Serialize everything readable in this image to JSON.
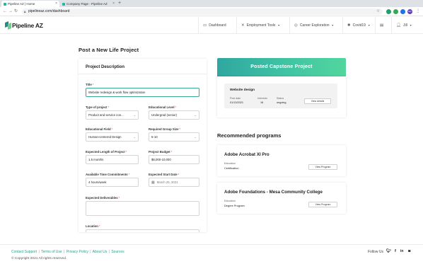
{
  "browser": {
    "tabs": [
      {
        "title": "Pipeline AZ | Home",
        "active": true
      },
      {
        "title": "Company Page - Pipeline AZ",
        "active": false
      }
    ],
    "new_tab": "+",
    "url": "pipelineaz.com/dashboard",
    "avatar": "ED"
  },
  "header": {
    "logo_text": "Pipeline AZ",
    "nav": [
      {
        "label": "Dashboard",
        "icon": "dashboard-icon"
      },
      {
        "label": "Employment Tools",
        "icon": "tools-icon"
      },
      {
        "label": "Career Exploration",
        "icon": "compass-icon"
      },
      {
        "label": "Covid19",
        "icon": "virus-icon"
      }
    ],
    "inbox_icon": "inbox-icon",
    "user": "Jill"
  },
  "page": {
    "title": "Post a New Life Project"
  },
  "form": {
    "section_title": "Project Description",
    "fields": {
      "title": {
        "label": "Title",
        "value": "Website redesign & work flow optimization"
      },
      "type_of_project": {
        "label": "Type of project",
        "value": "Product and service con..."
      },
      "educational_level": {
        "label": "Educational Level",
        "value": "Undergrad (senior)"
      },
      "educational_field": {
        "label": "Educational Field",
        "value": "Human-centered Design"
      },
      "group_size": {
        "label": "Required Group Size",
        "value": "5-10"
      },
      "length": {
        "label": "Expected Length of Project",
        "value": "1.5 months"
      },
      "budget": {
        "label": "Project Budget",
        "value": "$8,000-10,000"
      },
      "time_commitments": {
        "label": "Available Time Commitments",
        "value": "4 hours/week"
      },
      "start_date": {
        "label": "Expected Start Date",
        "value": "March 25, 2021"
      },
      "deliverables": {
        "label": "Expected Deliverables",
        "value": ""
      },
      "location": {
        "label": "Location",
        "value": ""
      }
    },
    "required_mark": "*"
  },
  "capstone": {
    "banner": "Posted Capstone Project",
    "project": {
      "title": "Website design",
      "post_date_label": "Post date",
      "post_date": "01/13/2021",
      "interests_label": "Interests",
      "interests": "16",
      "status_label": "Status",
      "status": "ongoing",
      "details_button": "View details"
    }
  },
  "recommended": {
    "title": "Recommended programs",
    "programs": [
      {
        "name": "Adobe Acrobat XI Pro",
        "category_label": "Education",
        "category": "Certification",
        "button": "View Program"
      },
      {
        "name": "Adobe Foundations - Mesa Community College",
        "category_label": "Education",
        "category": "Degree Program",
        "button": "View Program"
      }
    ]
  },
  "footer": {
    "links": [
      "Contact Support",
      "Terms of Use",
      "Privacy Policy",
      "About Us",
      "Sources"
    ],
    "separator": "|",
    "copyright": "© Copyright 2021 All rights reserved.",
    "follow": "Follow Us",
    "social": [
      "twitter-icon",
      "facebook-icon",
      "linkedin-icon",
      "instagram-icon"
    ]
  },
  "colors": {
    "accent": "#2a9e8e",
    "banner_start": "#2fa7a0",
    "banner_end": "#52d69e",
    "required": "#e24b4b"
  }
}
